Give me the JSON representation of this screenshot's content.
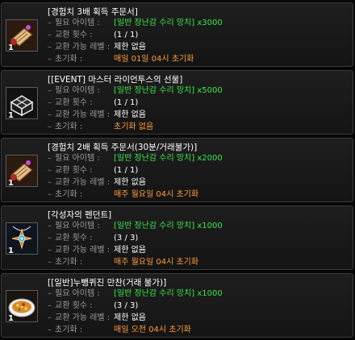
{
  "entries": [
    {
      "title": "[경험치 3배 획득 주문서]",
      "qty": "1",
      "icon": "scroll-icon",
      "req_label": "필요 아이템 :",
      "req_item": "[일반 장난감 수리 망치]",
      "req_count": "x3000",
      "count_label": "교환 횟수 :",
      "count_value": "(1 / 1)",
      "level_label": "교환 가능 레벨 :",
      "level_value": "제한 없음",
      "reset_label": "초기화 :",
      "reset_value": "매일 01일 04시 초기화"
    },
    {
      "title": "[[EVENT] 마스터 라이언투스의 선물]",
      "qty": "1",
      "icon": "gift-box-icon",
      "req_label": "필요 아이템 :",
      "req_item": "[일반 장난감 수리 망치]",
      "req_count": "x5000",
      "count_label": "교환 횟수 :",
      "count_value": "(1 / 1)",
      "level_label": "교환 가능 레벨 :",
      "level_value": "제한 없음",
      "reset_label": "초기화 :",
      "reset_value": "초기화 없음"
    },
    {
      "title": "[경험치 2배 획득 주문서(30분/거래불가)]",
      "qty": "1",
      "icon": "scroll-icon",
      "req_label": "필요 아이템 :",
      "req_item": "[일반 장난감 수리 망치]",
      "req_count": "x2000",
      "count_label": "교환 횟수 :",
      "count_value": "(1 / 1)",
      "level_label": "교환 가능 레벨 :",
      "level_value": "제한 없음",
      "reset_label": "초기화 :",
      "reset_value": "매주 월요일 04시 초기화"
    },
    {
      "title": "[각성자의 펜던트]",
      "qty": "1",
      "icon": "pendant-icon",
      "req_label": "필요 아이템 :",
      "req_item": "[일반 장난감 수리 망치]",
      "req_count": "x1000",
      "count_label": "교환 횟수 :",
      "count_value": "(3 / 3)",
      "level_label": "교환 가능 레벨 :",
      "level_value": "제한 없음",
      "reset_label": "초기화 :",
      "reset_value": "매주 월요일 04시 초기화"
    },
    {
      "title": "[[일반]누뺑퀴진 만찬(거래 불가)]",
      "qty": "1",
      "icon": "dish-icon",
      "req_label": "필요 아이템 :",
      "req_item": "[일반 장난감 수리 망치]",
      "req_count": "x1000",
      "count_label": "교환 횟수 :",
      "count_value": "(3 / 3)",
      "level_label": "교환 가능 레벨 :",
      "level_value": "제한 없음",
      "reset_label": "초기화 :",
      "reset_value": "매일 오전 04시 초기화"
    }
  ]
}
